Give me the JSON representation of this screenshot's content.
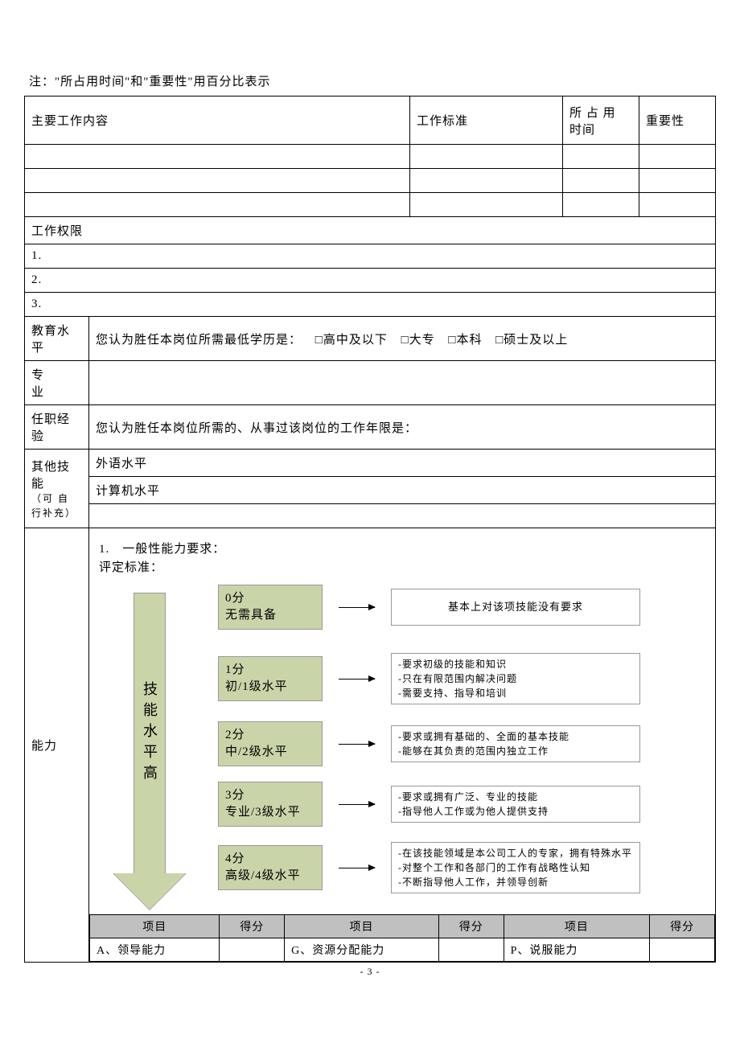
{
  "note": "注：\"所占用时间\"和\"重要性\"用百分比表示",
  "headers": {
    "content": "主要工作内容",
    "standard": "工作标准",
    "time": "所 占 用 时间",
    "importance": "重要性",
    "authority": "工作权限"
  },
  "authority_items": [
    "1.",
    "2.",
    "3."
  ],
  "edu": {
    "label": "教育水平",
    "prompt": "您认为胜任本岗位所需最低学历是：",
    "opts": [
      "□高中及以下",
      "□大专",
      "□本科",
      "□硕士及以上"
    ]
  },
  "major_label": "专　　业",
  "exp": {
    "label": "任职经验",
    "prompt": "您认为胜任本岗位所需的、从事过该岗位的工作年限是："
  },
  "skills": {
    "label": "其他技能",
    "sub": "（可 自 行补充）",
    "rows": [
      "外语水平",
      "计算机水平",
      ""
    ]
  },
  "ability": {
    "label": "能力",
    "sec_title": "1.　一般性能力要求：",
    "criteria": "评定标准：",
    "arrow": "技能水平高",
    "levels": [
      {
        "score": "0分",
        "name": "无需具备",
        "desc": [
          "基本上对该项技能没有要求"
        ]
      },
      {
        "score": "1分",
        "name": "初/1级水平",
        "desc": [
          "-要求初级的技能和知识",
          "-只在有限范围内解决问题",
          "-需要支持、指导和培训"
        ]
      },
      {
        "score": "2分",
        "name": "中/2级水平",
        "desc": [
          "-要求或拥有基础的、全面的基本技能",
          "-能够在其负责的范围内独立工作"
        ]
      },
      {
        "score": "3分",
        "name": "专业/3级水平",
        "desc": [
          "-要求或拥有广泛、专业的技能",
          "-指导他人工作或为他人提供支持"
        ]
      },
      {
        "score": "4分",
        "name": "高级/4级水平",
        "desc": [
          "-在该技能领域是本公司工人的专家，拥有特殊水平",
          "-对整个工作和各部门的工作有战略性认知",
          "-不断指导他人工作，并领导创新"
        ]
      }
    ]
  },
  "score_table": {
    "headers": [
      "项目",
      "得分",
      "项目",
      "得分",
      "项目",
      "得分"
    ],
    "row": [
      "A、领导能力",
      "",
      "G、资源分配能力",
      "",
      "P、说服能力",
      ""
    ]
  },
  "page_num": "- 3 -"
}
